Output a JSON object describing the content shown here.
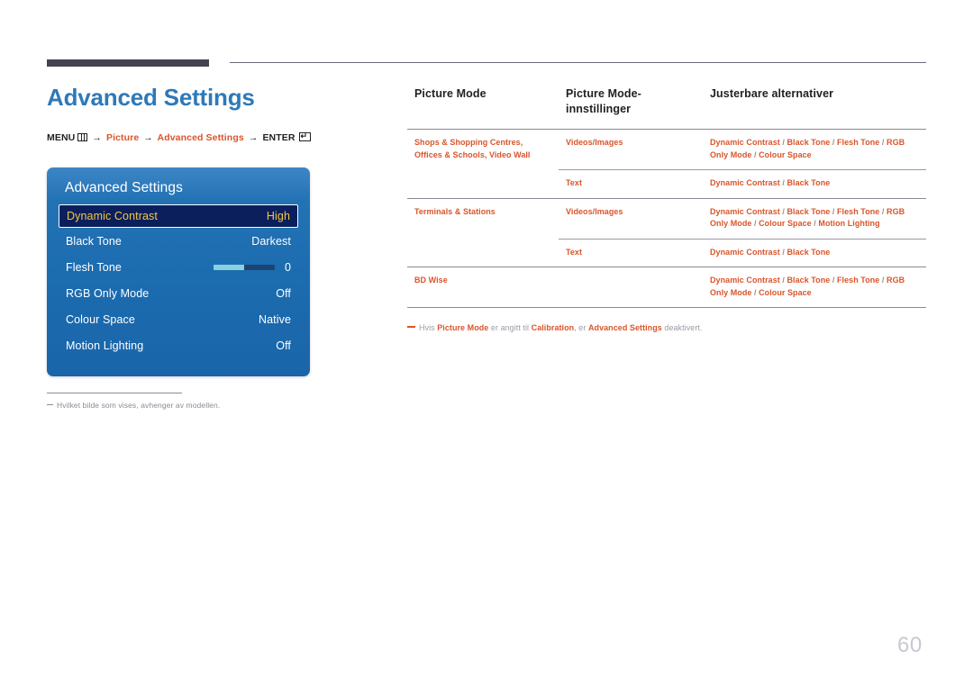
{
  "page": {
    "title": "Advanced Settings",
    "number": "60"
  },
  "breadcrumb": {
    "menu_label": "MENU",
    "menu_icon": "menu-grid-icon",
    "arrow": "→",
    "item1": "Picture",
    "item2": "Advanced Settings",
    "enter_label": "ENTER",
    "enter_icon": "enter-key-icon"
  },
  "osd": {
    "title": "Advanced Settings",
    "rows": [
      {
        "label": "Dynamic Contrast",
        "value": "High",
        "selected": true,
        "type": "value"
      },
      {
        "label": "Black Tone",
        "value": "Darkest",
        "selected": false,
        "type": "value"
      },
      {
        "label": "Flesh Tone",
        "value": "0",
        "selected": false,
        "type": "slider",
        "slider_percent": 50
      },
      {
        "label": "RGB Only Mode",
        "value": "Off",
        "selected": false,
        "type": "value"
      },
      {
        "label": "Colour Space",
        "value": "Native",
        "selected": false,
        "type": "value"
      },
      {
        "label": "Motion Lighting",
        "value": "Off",
        "selected": false,
        "type": "value"
      }
    ]
  },
  "left_note": {
    "text": "Hvilket bilde som vises, avhenger av modellen."
  },
  "table": {
    "headers": [
      "Picture Mode",
      "Picture Mode-innstillinger",
      "Justerbare alternativer"
    ],
    "rows": [
      {
        "col1": "Shops & Shopping Centres, Offices & Schools, Video Wall",
        "col2": "Videos/Images",
        "col3": "Dynamic Contrast / Black Tone / Flesh Tone / RGB Only Mode / Colour Space"
      },
      {
        "col1": "",
        "col2": "Text",
        "col3": "Dynamic Contrast / Black Tone"
      },
      {
        "col1": "Terminals & Stations",
        "col2": "Videos/Images",
        "col3": "Dynamic Contrast / Black Tone / Flesh Tone / RGB Only Mode / Colour Space / Motion Lighting"
      },
      {
        "col1": "",
        "col2": "Text",
        "col3": "Dynamic Contrast / Black Tone"
      },
      {
        "col1": "BD Wise",
        "col2": "",
        "col3": "Dynamic Contrast / Black Tone / Flesh Tone / RGB Only Mode / Colour Space"
      }
    ]
  },
  "table_note": {
    "prefix": "Hvis ",
    "term1": "Picture Mode",
    "mid1": " er angitt til ",
    "term2": "Calibration",
    "mid2": ", er ",
    "term3": "Advanced Settings",
    "suffix": " deaktivert."
  },
  "colors": {
    "title_blue": "#2e79b8",
    "accent_orange": "#d9552b",
    "osd_blue": "#1c6cb0",
    "osd_selected_bg": "#0b1f5c",
    "osd_selected_text": "#f5c842",
    "rule_dark": "#45434f",
    "muted_gray": "#8c8a97"
  }
}
